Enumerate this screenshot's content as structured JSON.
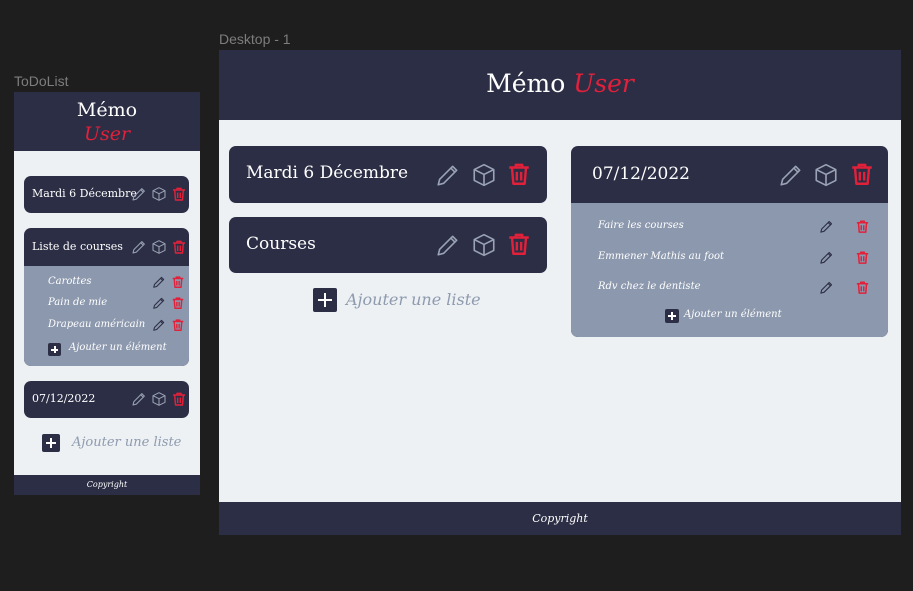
{
  "mobile_frame": {
    "frame_label": "ToDoList",
    "header": {
      "line1": "Mémo",
      "line2": "User"
    },
    "lists": [
      {
        "title": "Mardi 6 Décembre"
      },
      {
        "title": "Liste de courses",
        "items": [
          "Carottes",
          "Pain de mie",
          "Drapeau américain"
        ],
        "add_item_label": "Ajouter un élément"
      },
      {
        "title": "07/12/2022"
      }
    ],
    "add_list_label": "Ajouter une liste",
    "footer": "Copyright"
  },
  "desktop_frame": {
    "frame_label": "Desktop - 1",
    "header": {
      "part1": "Mémo",
      "part2": "User"
    },
    "lists": [
      {
        "title": "Mardi 6 Décembre"
      },
      {
        "title": "Courses"
      },
      {
        "title": "07/12/2022",
        "items": [
          "Faire les courses",
          "Emmener Mathis au  foot",
          "Rdv chez le dentiste"
        ],
        "add_item_label": "Ajouter un élément"
      }
    ],
    "add_list_label": "Ajouter une liste",
    "footer": "Copyright"
  },
  "icons": {
    "edit": "pencil-icon",
    "archive": "box-icon",
    "delete": "trash-icon",
    "add": "plus-icon"
  },
  "colors": {
    "background": "#1e1e1e",
    "navy": "#2c2e45",
    "accent_red": "#e2203a",
    "panel": "#edf1f4",
    "item_area": "#8c98ad",
    "muted_text": "#8e9aae"
  }
}
